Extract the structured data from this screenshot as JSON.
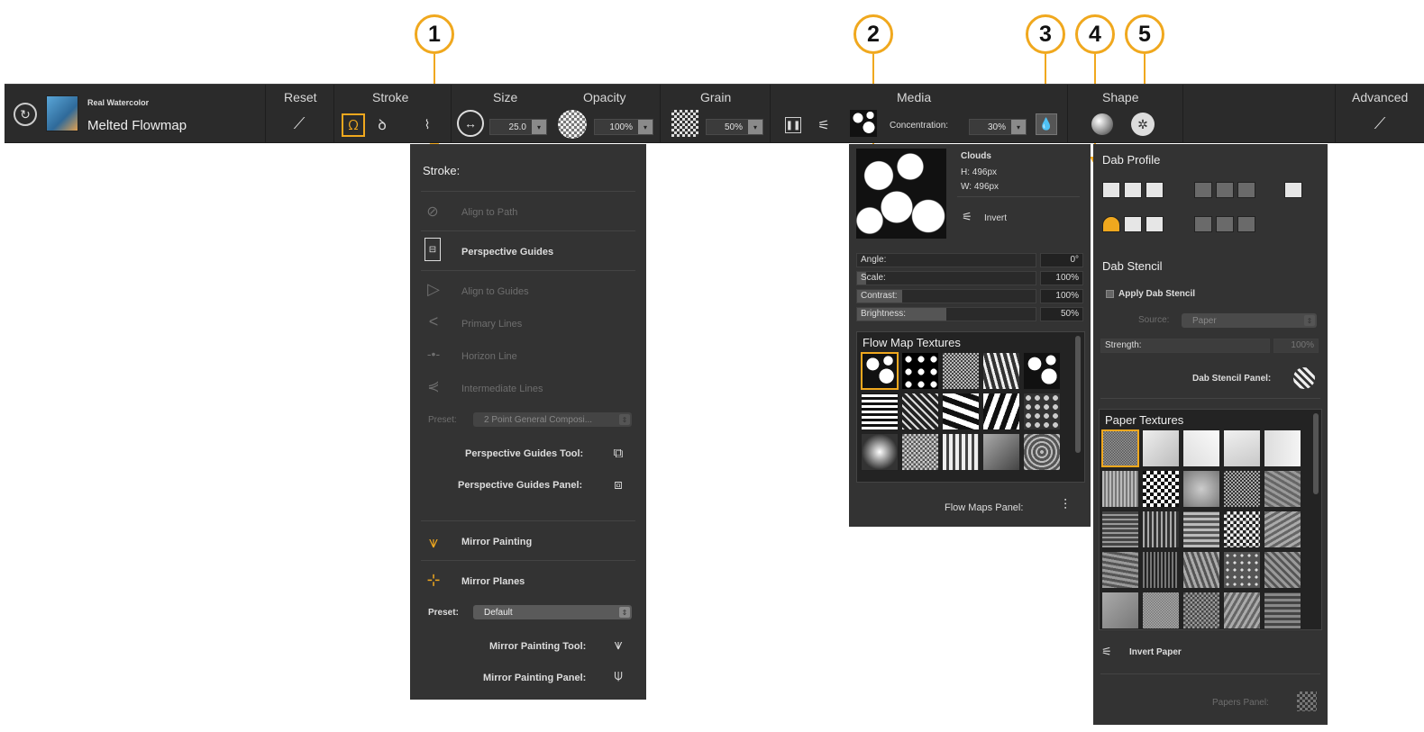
{
  "callouts": [
    "1",
    "2",
    "3",
    "4",
    "5"
  ],
  "toolbar": {
    "brush_category": "Real Watercolor",
    "brush_name": "Melted Flowmap",
    "sections": {
      "reset": "Reset",
      "stroke": "Stroke",
      "size": "Size",
      "opacity": "Opacity",
      "grain": "Grain",
      "media": "Media",
      "shape": "Shape",
      "advanced": "Advanced"
    },
    "size_value": "25.0",
    "opacity_value": "100%",
    "grain_value": "50%",
    "concentration_label": "Concentration:",
    "concentration_value": "30%"
  },
  "stroke_panel": {
    "title": "Stroke:",
    "items": {
      "align_path": "Align to Path",
      "perspective_guides": "Perspective Guides",
      "align_guides": "Align to Guides",
      "primary_lines": "Primary Lines",
      "horizon_line": "Horizon Line",
      "intermediate_lines": "Intermediate Lines"
    },
    "preset_label": "Preset:",
    "perspective_preset": "2 Point General Composi...",
    "perspective_tool_label": "Perspective Guides Tool:",
    "perspective_panel_label": "Perspective Guides Panel:",
    "mirror_painting": "Mirror Painting",
    "mirror_planes": "Mirror Planes",
    "mirror_preset": "Default",
    "mirror_tool_label": "Mirror Painting Tool:",
    "mirror_panel_label": "Mirror Painting Panel:"
  },
  "flow_panel": {
    "texture_name": "Clouds",
    "height": "H: 496px",
    "width": "W: 496px",
    "invert_label": "Invert",
    "sliders": {
      "angle_label": "Angle:",
      "angle_value": "0°",
      "angle_fill": 0,
      "scale_label": "Scale:",
      "scale_value": "100%",
      "scale_fill": 0.05,
      "contrast_label": "Contrast:",
      "contrast_value": "100%",
      "contrast_fill": 0.25,
      "brightness_label": "Brightness:",
      "brightness_value": "50%",
      "brightness_fill": 0.5
    },
    "textures_title": "Flow Map Textures",
    "panel_label": "Flow Maps Panel:"
  },
  "shape_panel": {
    "dab_profile_title": "Dab Profile",
    "dab_stencil_title": "Dab Stencil",
    "apply_label": "Apply Dab Stencil",
    "source_label": "Source:",
    "source_value": "Paper",
    "strength_label": "Strength:",
    "strength_value": "100%",
    "stencil_panel_label": "Dab Stencil Panel:",
    "paper_title": "Paper Textures",
    "invert_paper_label": "Invert Paper",
    "papers_panel_label": "Papers Panel:"
  },
  "colors": {
    "accent": "#f0a81e",
    "bar": "#2b2b2b",
    "panel": "#333333"
  }
}
